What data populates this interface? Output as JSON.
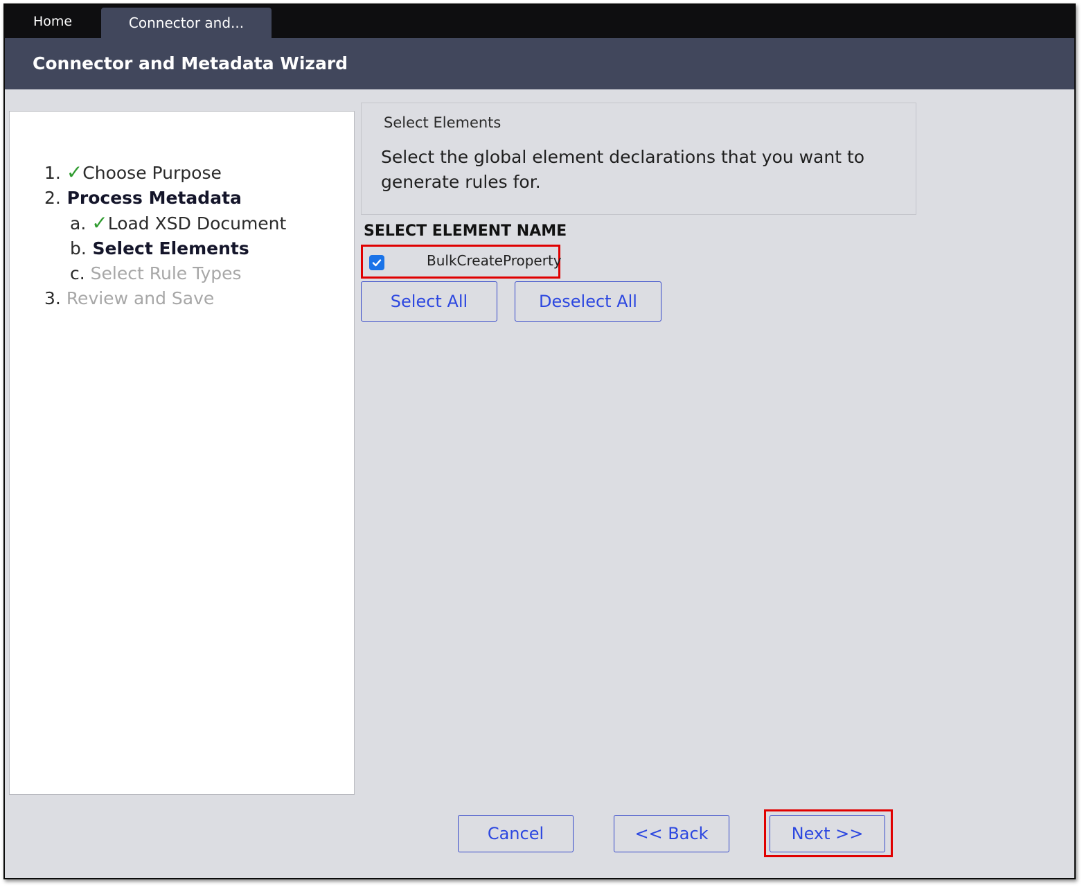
{
  "tabs": {
    "home": "Home",
    "active": "Connector and..."
  },
  "header": {
    "title": "Connector and Metadata Wizard"
  },
  "steps": [
    {
      "num": "1.",
      "label": "Choose Purpose",
      "state": "done"
    },
    {
      "num": "2.",
      "label": "Process Metadata",
      "state": "current"
    },
    {
      "num": "a.",
      "label": "Load XSD Document",
      "state": "done"
    },
    {
      "num": "b.",
      "label": "Select Elements",
      "state": "current"
    },
    {
      "num": "c.",
      "label": "Select Rule Types",
      "state": "future"
    },
    {
      "num": "3.",
      "label": "Review and Save",
      "state": "future"
    }
  ],
  "check_glyph": "✓",
  "info": {
    "title": "Select Elements",
    "text": "Select the global element declarations that you want to generate rules for."
  },
  "table": {
    "column_header": "SELECT ELEMENT NAME",
    "elements": [
      {
        "name": "BulkCreateProperty",
        "checked": true
      }
    ]
  },
  "buttons": {
    "select_all": "Select All",
    "deselect_all": "Deselect All",
    "cancel": "Cancel",
    "back": "<< Back",
    "next": "Next >>"
  },
  "colors": {
    "header_bg": "#41475c",
    "tabbar_bg": "#0e0e10",
    "check_green": "#2f9b2f",
    "button_text": "#2c47e0",
    "highlight_red": "#e00000",
    "checkbox_blue": "#1a73e8"
  }
}
